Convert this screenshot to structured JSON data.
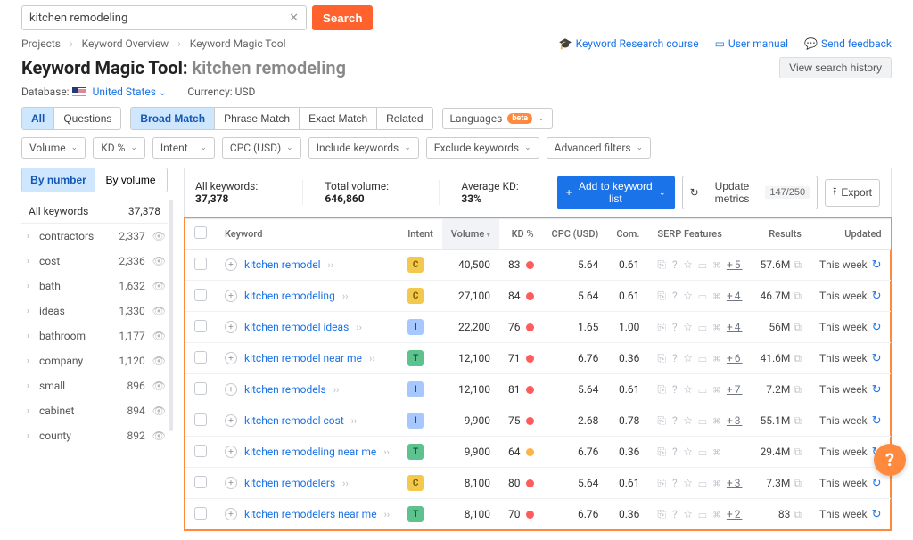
{
  "search": {
    "value": "kitchen remodeling",
    "button": "Search"
  },
  "breadcrumb": {
    "items": [
      "Projects",
      "Keyword Overview",
      "Keyword Magic Tool"
    ]
  },
  "top_links": {
    "course": "Keyword Research course",
    "manual": "User manual",
    "feedback": "Send feedback"
  },
  "title": {
    "prefix": "Keyword Magic Tool:",
    "term": "kitchen remodeling"
  },
  "history_button": "View search history",
  "database": {
    "label": "Database:",
    "country": "United States"
  },
  "currency": {
    "label_full": "Currency: USD"
  },
  "match_tabs": {
    "all": "All",
    "questions": "Questions",
    "broad": "Broad Match",
    "phrase": "Phrase Match",
    "exact": "Exact Match",
    "related": "Related"
  },
  "languages_pill": {
    "label": "Languages",
    "badge": "beta"
  },
  "filters": {
    "volume": "Volume",
    "kd": "KD %",
    "intent": "Intent",
    "cpc": "CPC (USD)",
    "include": "Include keywords",
    "exclude": "Exclude keywords",
    "advanced": "Advanced filters"
  },
  "sidebar": {
    "by_number": "By number",
    "by_volume": "By volume",
    "all_label": "All keywords",
    "all_count": "37,378",
    "groups": [
      {
        "name": "contractors",
        "count": "2,337"
      },
      {
        "name": "cost",
        "count": "2,336"
      },
      {
        "name": "bath",
        "count": "1,632"
      },
      {
        "name": "ideas",
        "count": "1,330"
      },
      {
        "name": "bathroom",
        "count": "1,177"
      },
      {
        "name": "company",
        "count": "1,120"
      },
      {
        "name": "small",
        "count": "896"
      },
      {
        "name": "cabinet",
        "count": "894"
      },
      {
        "name": "county",
        "count": "892"
      }
    ]
  },
  "summary": {
    "all_label": "All keywords:",
    "all_value": "37,378",
    "total_label": "Total volume:",
    "total_value": "646,860",
    "kd_label": "Average KD:",
    "kd_value": "33%",
    "add_button": "Add to keyword list",
    "update_button": "Update metrics",
    "update_count": "147/250",
    "export_button": "Export"
  },
  "table": {
    "headers": {
      "keyword": "Keyword",
      "intent": "Intent",
      "volume": "Volume",
      "kd": "KD %",
      "cpc": "CPC (USD)",
      "com": "Com.",
      "serp": "SERP Features",
      "results": "Results",
      "updated": "Updated"
    },
    "rows": [
      {
        "kw": "kitchen remodel",
        "intent": "C",
        "vol": "40,500",
        "kd": "83",
        "kd_color": "red",
        "cpc": "5.64",
        "com": "0.61",
        "serp_more": "+5",
        "results": "57.6M",
        "updated": "This week"
      },
      {
        "kw": "kitchen remodeling",
        "intent": "C",
        "vol": "27,100",
        "kd": "84",
        "kd_color": "red",
        "cpc": "5.64",
        "com": "0.61",
        "serp_more": "+4",
        "results": "46.7M",
        "updated": "This week"
      },
      {
        "kw": "kitchen remodel ideas",
        "intent": "I",
        "vol": "22,200",
        "kd": "76",
        "kd_color": "red",
        "cpc": "1.65",
        "com": "1.00",
        "serp_more": "+4",
        "results": "56M",
        "updated": "This week"
      },
      {
        "kw": "kitchen remodel near me",
        "intent": "T",
        "vol": "12,100",
        "kd": "71",
        "kd_color": "red",
        "cpc": "6.76",
        "com": "0.36",
        "serp_more": "+6",
        "results": "41.6M",
        "updated": "This week"
      },
      {
        "kw": "kitchen remodels",
        "intent": "I",
        "vol": "12,100",
        "kd": "81",
        "kd_color": "red",
        "cpc": "5.64",
        "com": "0.61",
        "serp_more": "+7",
        "results": "7.2M",
        "updated": "This week"
      },
      {
        "kw": "kitchen remodel cost",
        "intent": "I",
        "vol": "9,900",
        "kd": "75",
        "kd_color": "red",
        "cpc": "2.68",
        "com": "0.78",
        "serp_more": "+3",
        "results": "55.1M",
        "updated": "This week"
      },
      {
        "kw": "kitchen remodeling near me",
        "intent": "T",
        "vol": "9,900",
        "kd": "64",
        "kd_color": "orange",
        "cpc": "6.76",
        "com": "0.36",
        "serp_more": "",
        "results": "29.4M",
        "updated": "This week"
      },
      {
        "kw": "kitchen remodelers",
        "intent": "C",
        "vol": "8,100",
        "kd": "80",
        "kd_color": "red",
        "cpc": "5.64",
        "com": "0.61",
        "serp_more": "+3",
        "results": "7.3M",
        "updated": "This week"
      },
      {
        "kw": "kitchen remodelers near me",
        "intent": "T",
        "vol": "8,100",
        "kd": "70",
        "kd_color": "red",
        "cpc": "6.76",
        "com": "0.36",
        "serp_more": "+2",
        "results": "83",
        "updated": "This week"
      }
    ]
  },
  "help": "?"
}
